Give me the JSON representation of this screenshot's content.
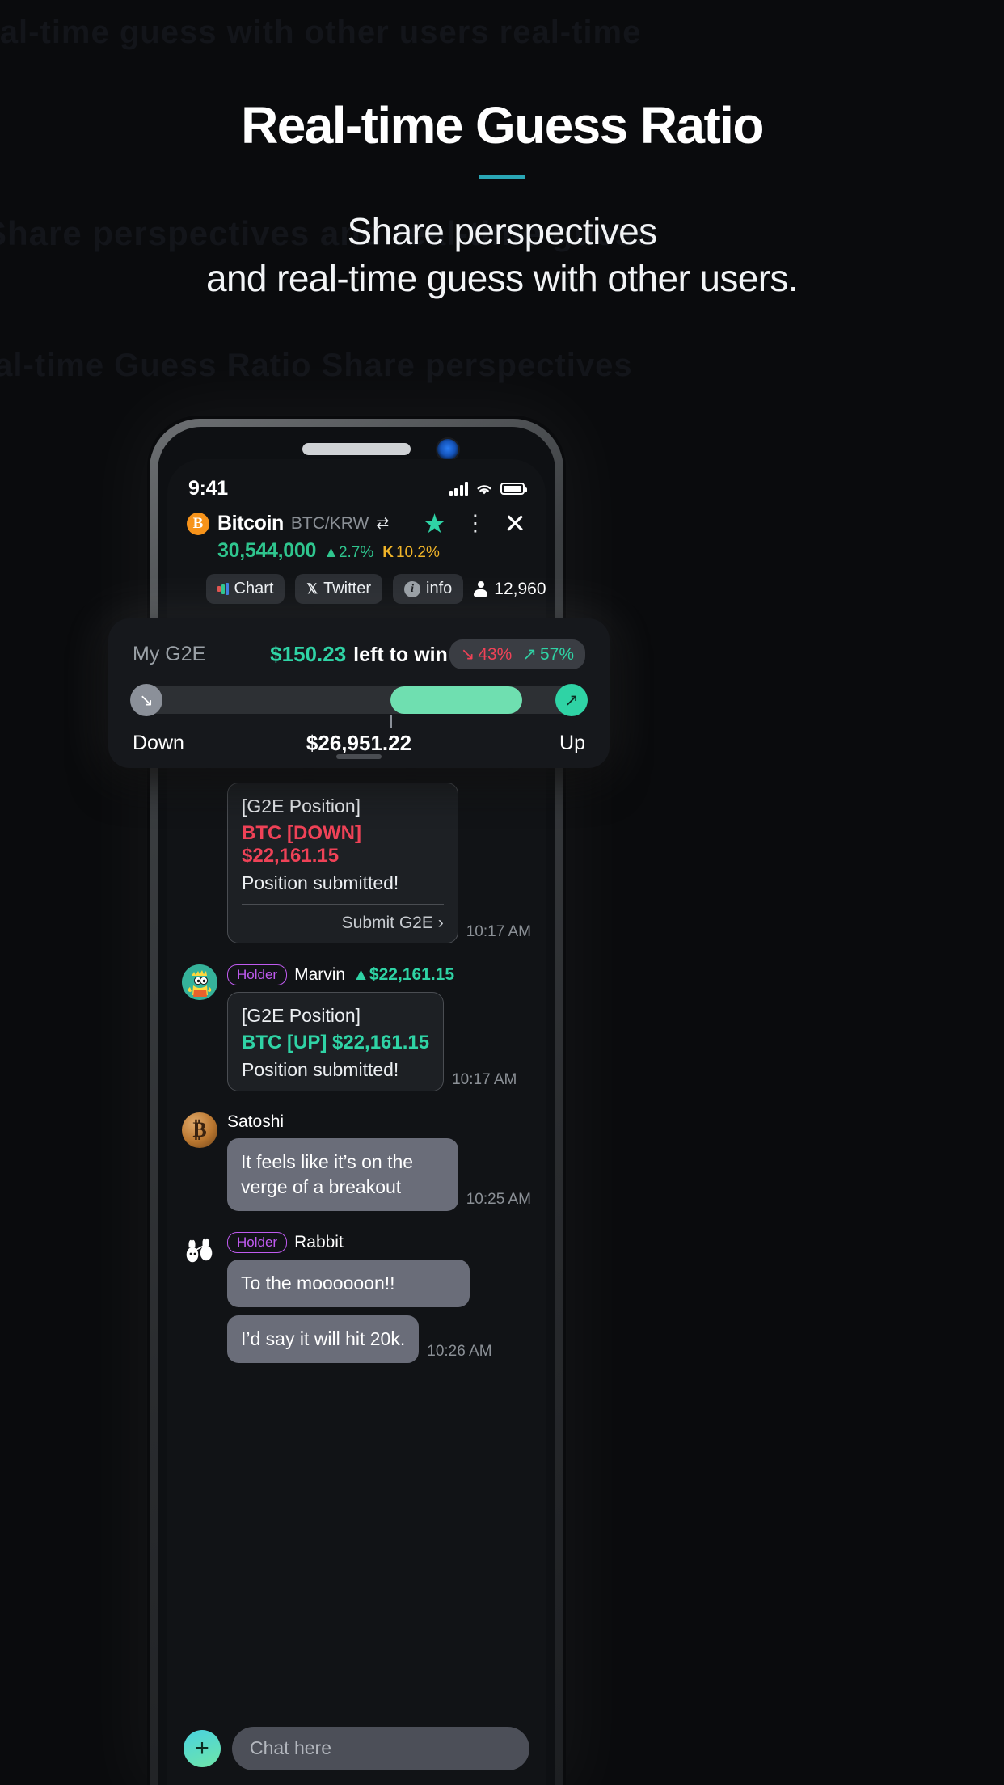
{
  "hero": {
    "headline": "Real-time Guess Ratio",
    "subtitle_line1": "Share perspectives",
    "subtitle_line2": "and real-time guess with other users.",
    "accent_color": "#2aa7b5"
  },
  "ghost_text": {
    "line1": "real-time guess with other users real-time",
    "line2": "Share perspectives and real-time guess",
    "line3": "Real-time Guess Ratio Share perspectives"
  },
  "statusbar": {
    "time": "9:41",
    "signal_icon": "signal-bars-icon",
    "wifi_icon": "wifi-icon",
    "battery_icon": "battery-icon"
  },
  "ticker": {
    "logo_glyph": "Ƀ",
    "coin_name": "Bitcoin",
    "pair": "BTC/KRW",
    "swap_icon": "⇄",
    "price": "30,544,000",
    "change_arrow": "▲",
    "change_pct": "2.7%",
    "kimchi_mark": "K",
    "kimchi_pct": "10.2%",
    "price_color": "#2fc58e",
    "kimchi_color": "#f0b429",
    "star_icon": "★",
    "kebab_icon": "⋮",
    "close_icon": "✕"
  },
  "tabs": [
    {
      "label": "Chart",
      "icon": "bar-chart-icon"
    },
    {
      "label": "Twitter",
      "icon": "x-twitter-icon"
    },
    {
      "label": "info",
      "icon": "info-circle-icon"
    }
  ],
  "viewers": {
    "icon": "person-icon",
    "count": "12,960"
  },
  "g2e_card": {
    "label": "My G2E",
    "amount": "$150.23",
    "amount_suffix": "left to win",
    "ratio_down_arrow": "↘",
    "ratio_down": "43%",
    "ratio_up_arrow": "↗",
    "ratio_up": "57%",
    "ratio_down_color": "#ef4257",
    "ratio_up_color": "#2fd3a5",
    "slider": {
      "down_label": "Down",
      "up_label": "Up",
      "current_price": "$26,951.22",
      "down_knob_icon": "↘",
      "up_knob_icon": "↗",
      "fill_start_pct": 57,
      "fill_end_pct": 86,
      "tick_pct": 57
    }
  },
  "chat": {
    "messages": [
      {
        "kind": "position",
        "title": "[G2E Position]",
        "direction": "BTC [DOWN] $22,161.15",
        "direction_color": "#ef4257",
        "subtext": "Position submitted!",
        "submit_label": "Submit G2E",
        "submit_chevron": "›",
        "time": "10:17 AM"
      },
      {
        "kind": "position",
        "badge": "Holder",
        "name": "Marvin",
        "pos_arrow": "▲",
        "pos_value": "$22,161.15",
        "avatar": "marvin-avatar",
        "title": "[G2E Position]",
        "direction": "BTC [UP] $22,161.15",
        "direction_color": "#2fd3a5",
        "subtext": "Position submitted!",
        "time": "10:17 AM"
      },
      {
        "kind": "text",
        "name": "Satoshi",
        "avatar": "satoshi-avatar",
        "text": "It feels like it’s on the verge of a breakout",
        "time": "10:25 AM"
      },
      {
        "kind": "text-multi",
        "badge": "Holder",
        "name": "Rabbit",
        "avatar": "rabbit-avatar",
        "texts": [
          "To the moooooon!!",
          "I’d say it will hit 20k."
        ],
        "time": "10:26 AM"
      }
    ]
  },
  "composer": {
    "plus_icon": "+",
    "placeholder": "Chat here"
  }
}
